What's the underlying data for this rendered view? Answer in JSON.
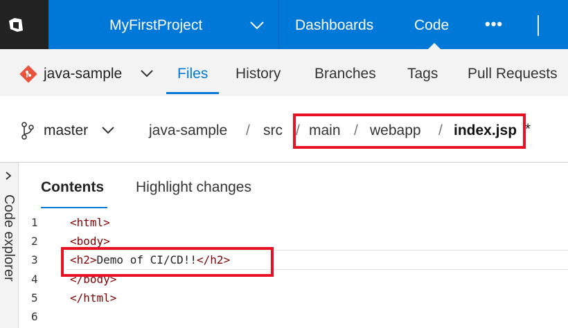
{
  "topbar": {
    "logo_icon": "visual-studio-team-services-logo",
    "project_name": "MyFirstProject",
    "nav": [
      {
        "label": "Dashboards"
      },
      {
        "label": "Code"
      }
    ],
    "more_label": "•••",
    "colors": {
      "bar": "#0078d7",
      "logo_bg": "#222222"
    }
  },
  "subnav": {
    "repo_icon": "git-repo-icon",
    "repo_name": "java-sample",
    "tabs": [
      {
        "label": "Files",
        "active": true
      },
      {
        "label": "History"
      },
      {
        "label": "Branches"
      },
      {
        "label": "Tags"
      },
      {
        "label": "Pull Requests"
      }
    ]
  },
  "breadcrumb": {
    "branch_icon": "branch-icon",
    "branch": "master",
    "path": [
      "java-sample",
      "src",
      "main",
      "webapp",
      "index.jsp"
    ],
    "separator": "/",
    "modified_marker": "*"
  },
  "explorer": {
    "label": "Code explorer"
  },
  "content_tabs": [
    {
      "label": "Contents",
      "active": true
    },
    {
      "label": "Highlight changes"
    }
  ],
  "code": {
    "lines": [
      {
        "no": "1",
        "open": "<html>",
        "text": "",
        "close": ""
      },
      {
        "no": "2",
        "open": "<body>",
        "text": "",
        "close": ""
      },
      {
        "no": "3",
        "open": "<h2>",
        "text": "Demo of CI/CD!!",
        "close": "</h2>"
      },
      {
        "no": "4",
        "open": "</body>",
        "text": "",
        "close": ""
      },
      {
        "no": "5",
        "open": "</html>",
        "text": "",
        "close": ""
      },
      {
        "no": "6",
        "open": "",
        "text": "",
        "close": ""
      }
    ]
  },
  "highlight_color": "#e81123"
}
